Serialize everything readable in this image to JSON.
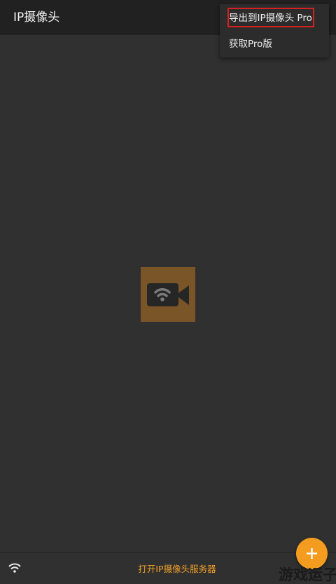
{
  "app_bar": {
    "title": "IP摄像头"
  },
  "overflow_menu": {
    "items": [
      {
        "label": "导出到IP摄像头 Pro",
        "highlighted": true
      },
      {
        "label": "获取Pro版",
        "highlighted": false
      }
    ],
    "highlight_color": "#d8201f"
  },
  "center_logo": {
    "icon": "wifi-camera-icon",
    "background": "#7a5528"
  },
  "bottom_bar": {
    "wifi_icon": "wifi-icon",
    "server_button_label": "打开IP摄像头服务器",
    "accent": "#f0a028"
  },
  "fab": {
    "icon": "plus-icon",
    "color": "#f39c1f"
  },
  "watermark": {
    "text": "游戏运子"
  }
}
